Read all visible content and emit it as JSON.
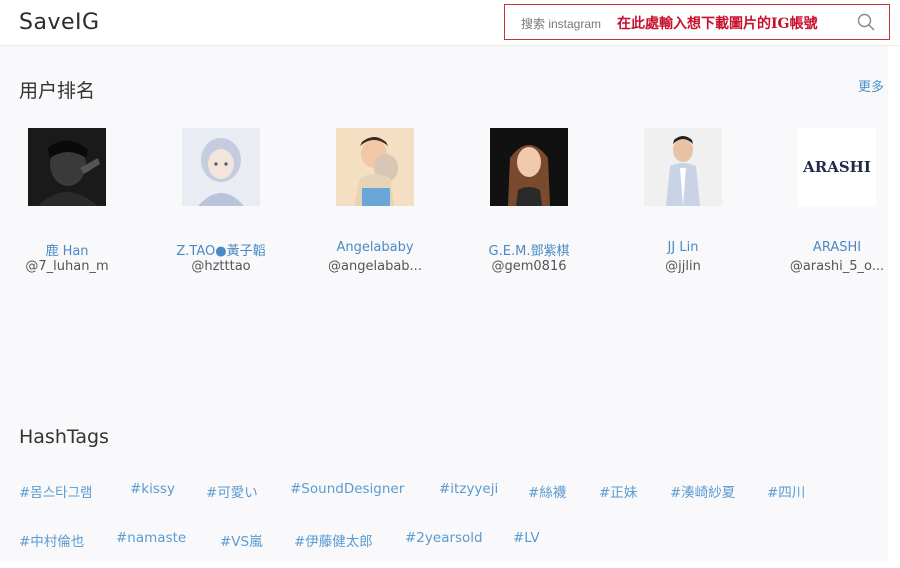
{
  "header": {
    "logo": "SaveIG",
    "search_placeholder": "搜索 instagram",
    "search_note": "在此處輸入想下載圖片的IG帳號",
    "search_icon": "search-icon"
  },
  "ranking": {
    "title": "用户排名",
    "more_label": "更多",
    "users": [
      {
        "name": "鹿 Han",
        "handle": "@7_luhan_m",
        "avatar": "dark-portrait"
      },
      {
        "name": "Z.TAO●黃子韜",
        "handle": "@hztttao",
        "avatar": "illustrated-portrait"
      },
      {
        "name": "Angelababy",
        "handle": "@angelabab...",
        "avatar": "child-portrait"
      },
      {
        "name": "G.E.M.鄧紫棋",
        "handle": "@gem0816",
        "avatar": "woman-portrait"
      },
      {
        "name": "JJ Lin",
        "handle": "@jjlin",
        "avatar": "man-portrait"
      },
      {
        "name": "ARASHI",
        "handle": "@arashi_5_o...",
        "avatar_text": "ARASHI"
      }
    ]
  },
  "hashtags": {
    "title": "HashTags",
    "row1": [
      "#몸스타그램",
      "#kissy",
      "#可愛い",
      "#SoundDesigner",
      "#itzyyeji",
      "#絲襪",
      "#正妹",
      "#湊崎紗夏",
      "#四川"
    ],
    "row2": [
      "#中村倫也",
      "#namaste",
      "#VS嵐",
      "#伊藤健太郎",
      "#2yearsold",
      "#LV"
    ]
  },
  "colors": {
    "accent_link": "#4a8ac4",
    "search_border": "#c8333b",
    "note_red": "#c8102e"
  }
}
